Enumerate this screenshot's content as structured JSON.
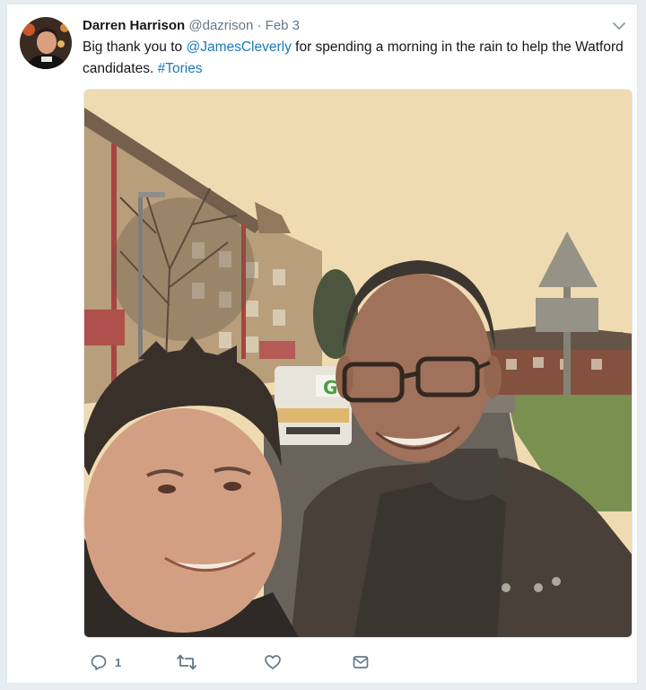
{
  "tweet": {
    "fullname": "Darren Harrison",
    "handle": "@dazrison",
    "separator": "·",
    "date": "Feb 3",
    "text_before": "Big thank you to ",
    "mention": "@JamesCleverly",
    "text_middle": " for spending a morning in the rain to help the Watford candidates. ",
    "hashtag": "#Tories",
    "reply_count": "1"
  },
  "icons": {
    "caret": "chevron-down-icon",
    "reply": "reply-icon",
    "retweet": "retweet-icon",
    "like": "heart-icon",
    "message": "message-icon"
  },
  "colors": {
    "link": "#1b7ab8",
    "muted": "#657786",
    "sky": "#f0ddb4"
  }
}
